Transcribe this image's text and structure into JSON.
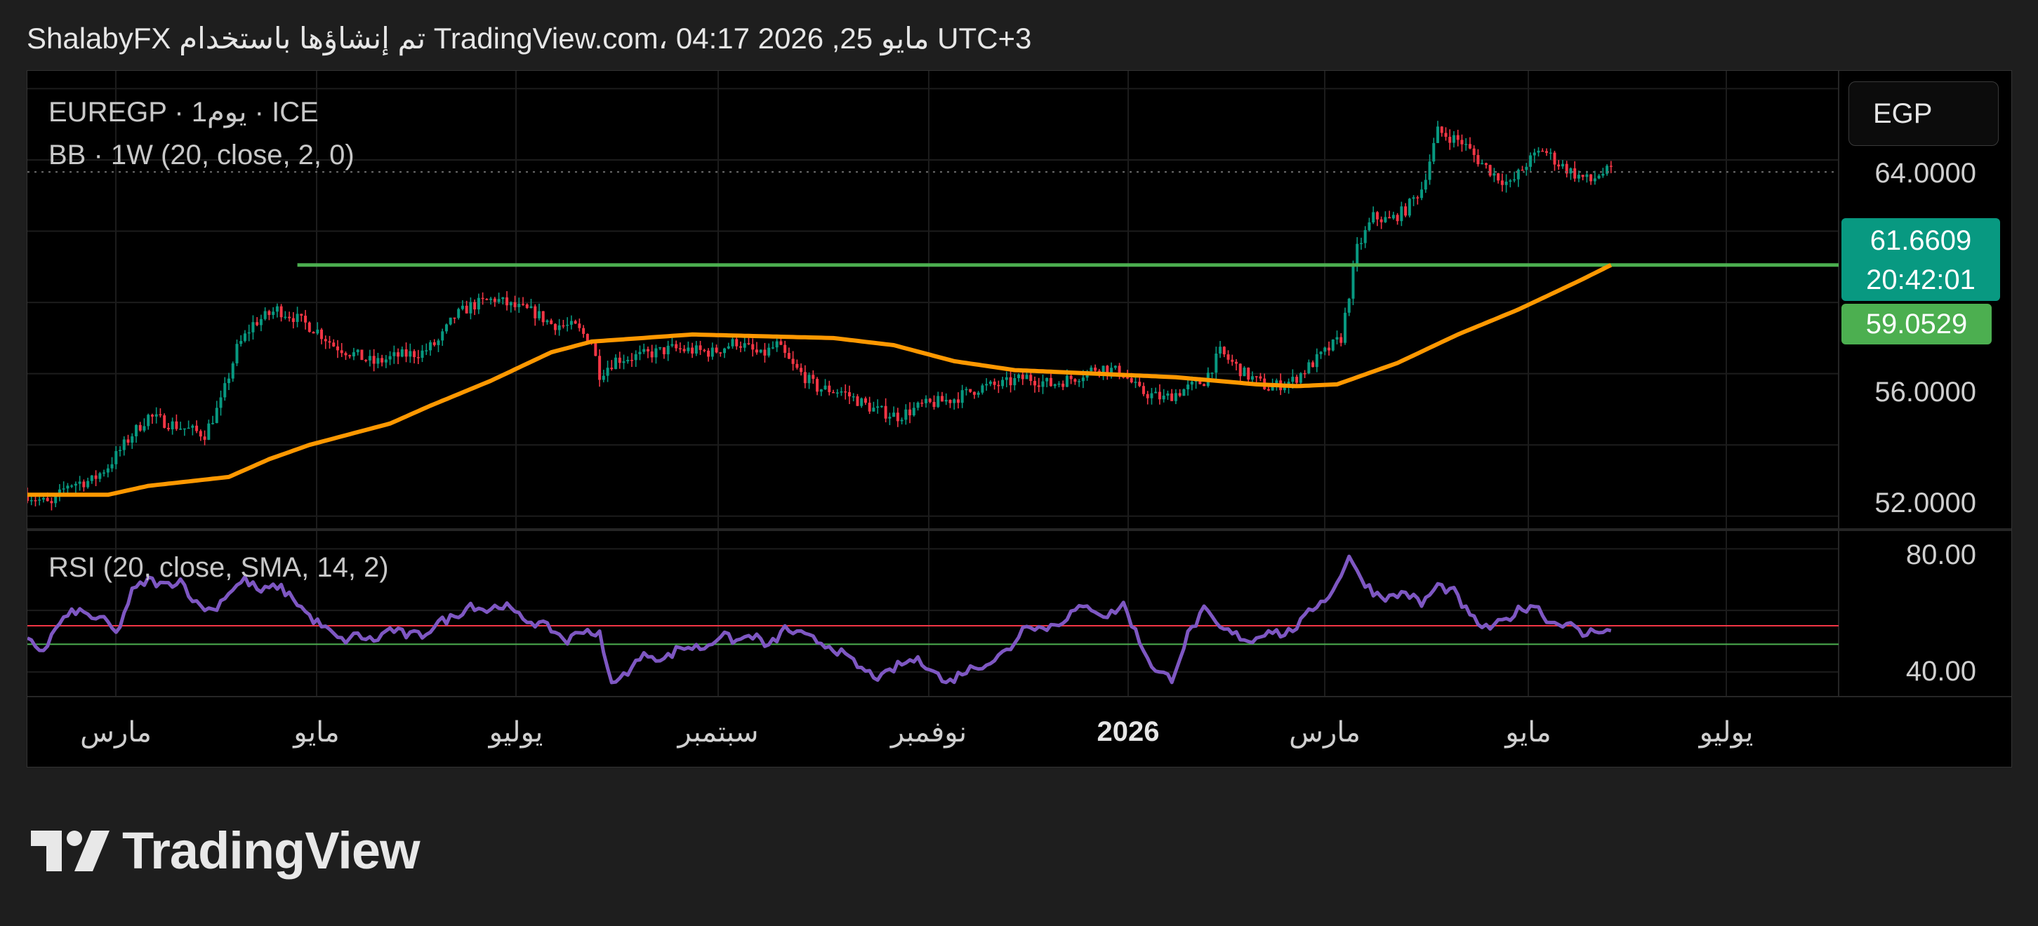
{
  "header": {
    "text": "ShalabyFX تم إنشاؤها باستخدام TradingView.com، 04:17 2026 ,25 مايو UTC+3"
  },
  "legend": {
    "symbol": "EUREGP · 1يوم · ICE",
    "bb": "BB · 1W (20, close, 2, 0)",
    "rsi": "RSI (20, close, SMA, 14, 2)"
  },
  "currency_button": "EGP",
  "price_label": {
    "price": "61.6609",
    "countdown": "20:42:01"
  },
  "bb_label": "59.0529",
  "logo": {
    "text": "TradingView"
  },
  "colors": {
    "background": "#000000",
    "up": "#089981",
    "down": "#f23645",
    "bb_basis": "#ff9800",
    "horizontal_line": "#4caf50",
    "rsi": "#7e57c2",
    "rsi_upper": "#f23645",
    "rsi_lower": "#4caf50"
  },
  "chart_data": [
    {
      "type": "candlestick",
      "title": "EUREGP",
      "y_ticks": [
        "64.0000",
        "56.0000",
        "52.0000"
      ],
      "ylim": [
        51.7,
        64.5
      ],
      "x_ticks": [
        "مارس",
        "مايو",
        "يوليو",
        "سبتمبر",
        "نوفمبر",
        "2026",
        "مارس",
        "مايو",
        "يوليو"
      ],
      "close_path": [
        [
          0,
          52.6
        ],
        [
          6,
          52.3
        ],
        [
          10,
          52.9
        ],
        [
          16,
          53.0
        ],
        [
          20,
          53.4
        ],
        [
          26,
          54.3
        ],
        [
          30,
          54.8
        ],
        [
          38,
          54.5
        ],
        [
          44,
          54.3
        ],
        [
          48,
          55.2
        ],
        [
          52,
          56.7
        ],
        [
          56,
          57.4
        ],
        [
          62,
          57.8
        ],
        [
          66,
          57.6
        ],
        [
          72,
          57.2
        ],
        [
          76,
          56.8
        ],
        [
          82,
          56.5
        ],
        [
          86,
          56.3
        ],
        [
          92,
          56.5
        ],
        [
          98,
          56.6
        ],
        [
          102,
          56.9
        ],
        [
          106,
          57.6
        ],
        [
          110,
          57.9
        ],
        [
          116,
          58.1
        ],
        [
          120,
          57.9
        ],
        [
          126,
          57.7
        ],
        [
          130,
          57.4
        ],
        [
          136,
          57.3
        ],
        [
          140,
          56.9
        ],
        [
          142,
          56.0
        ],
        [
          146,
          56.4
        ],
        [
          152,
          56.5
        ],
        [
          160,
          56.7
        ],
        [
          170,
          56.6
        ],
        [
          176,
          56.9
        ],
        [
          182,
          56.5
        ],
        [
          186,
          56.8
        ],
        [
          190,
          56.2
        ],
        [
          196,
          55.6
        ],
        [
          202,
          55.5
        ],
        [
          210,
          55.0
        ],
        [
          216,
          54.8
        ],
        [
          222,
          55.1
        ],
        [
          230,
          55.3
        ],
        [
          236,
          55.6
        ],
        [
          242,
          55.7
        ],
        [
          248,
          55.9
        ],
        [
          254,
          55.7
        ],
        [
          260,
          55.9
        ],
        [
          266,
          56.2
        ],
        [
          272,
          56.0
        ],
        [
          276,
          55.5
        ],
        [
          282,
          55.3
        ],
        [
          288,
          55.6
        ],
        [
          292,
          55.8
        ],
        [
          296,
          56.6
        ],
        [
          302,
          56.0
        ],
        [
          308,
          55.6
        ],
        [
          314,
          55.8
        ],
        [
          320,
          56.4
        ],
        [
          326,
          57.0
        ],
        [
          330,
          59.5
        ],
        [
          334,
          60.4
        ],
        [
          338,
          60.3
        ],
        [
          342,
          60.6
        ],
        [
          346,
          61.2
        ],
        [
          350,
          62.8
        ],
        [
          356,
          62.5
        ],
        [
          360,
          62.0
        ],
        [
          364,
          61.6
        ],
        [
          368,
          61.3
        ],
        [
          372,
          61.9
        ],
        [
          376,
          62.3
        ],
        [
          380,
          61.9
        ],
        [
          384,
          61.6
        ],
        [
          388,
          61.4
        ],
        [
          390,
          61.6
        ],
        [
          393,
          61.7
        ]
      ],
      "bb_basis": [
        [
          0,
          52.6
        ],
        [
          20,
          52.6
        ],
        [
          30,
          52.85
        ],
        [
          50,
          53.1
        ],
        [
          60,
          53.6
        ],
        [
          70,
          54.0
        ],
        [
          90,
          54.6
        ],
        [
          100,
          55.1
        ],
        [
          115,
          55.8
        ],
        [
          130,
          56.6
        ],
        [
          140,
          56.9
        ],
        [
          165,
          57.1
        ],
        [
          200,
          57.0
        ],
        [
          215,
          56.8
        ],
        [
          230,
          56.35
        ],
        [
          245,
          56.1
        ],
        [
          265,
          56.0
        ],
        [
          285,
          55.9
        ],
        [
          305,
          55.7
        ],
        [
          315,
          55.65
        ],
        [
          325,
          55.7
        ],
        [
          340,
          56.3
        ],
        [
          355,
          57.1
        ],
        [
          370,
          57.8
        ],
        [
          385,
          58.6
        ],
        [
          393,
          59.05
        ]
      ],
      "horizontal_line": 59.05,
      "last_price": 61.6609
    },
    {
      "type": "line",
      "title": "RSI",
      "y_ticks": [
        "80.00",
        "40.00"
      ],
      "ylim": [
        32,
        86
      ],
      "levels": [
        55,
        49
      ],
      "rsi_path": [
        [
          0,
          50
        ],
        [
          4,
          47
        ],
        [
          8,
          56
        ],
        [
          12,
          60
        ],
        [
          16,
          58
        ],
        [
          20,
          56
        ],
        [
          22,
          52
        ],
        [
          26,
          66
        ],
        [
          30,
          70
        ],
        [
          34,
          68
        ],
        [
          38,
          70
        ],
        [
          42,
          62
        ],
        [
          46,
          60
        ],
        [
          50,
          66
        ],
        [
          54,
          70
        ],
        [
          58,
          66
        ],
        [
          62,
          68
        ],
        [
          66,
          64
        ],
        [
          70,
          58
        ],
        [
          74,
          54
        ],
        [
          78,
          50
        ],
        [
          82,
          52
        ],
        [
          86,
          50
        ],
        [
          90,
          54
        ],
        [
          94,
          52
        ],
        [
          98,
          52
        ],
        [
          102,
          56
        ],
        [
          106,
          58
        ],
        [
          110,
          62
        ],
        [
          114,
          60
        ],
        [
          118,
          62
        ],
        [
          122,
          58
        ],
        [
          126,
          56
        ],
        [
          130,
          54
        ],
        [
          134,
          50
        ],
        [
          138,
          54
        ],
        [
          142,
          52
        ],
        [
          144,
          40
        ],
        [
          146,
          36
        ],
        [
          150,
          42
        ],
        [
          154,
          46
        ],
        [
          158,
          44
        ],
        [
          162,
          48
        ],
        [
          168,
          48
        ],
        [
          172,
          52
        ],
        [
          176,
          50
        ],
        [
          180,
          52
        ],
        [
          184,
          48
        ],
        [
          188,
          54
        ],
        [
          192,
          52
        ],
        [
          196,
          50
        ],
        [
          200,
          48
        ],
        [
          204,
          44
        ],
        [
          208,
          40
        ],
        [
          212,
          38
        ],
        [
          216,
          42
        ],
        [
          220,
          44
        ],
        [
          224,
          42
        ],
        [
          228,
          36
        ],
        [
          232,
          40
        ],
        [
          236,
          42
        ],
        [
          240,
          44
        ],
        [
          244,
          48
        ],
        [
          248,
          56
        ],
        [
          252,
          54
        ],
        [
          256,
          56
        ],
        [
          260,
          60
        ],
        [
          264,
          61
        ],
        [
          268,
          58
        ],
        [
          272,
          62
        ],
        [
          276,
          50
        ],
        [
          280,
          40
        ],
        [
          284,
          38
        ],
        [
          288,
          52
        ],
        [
          292,
          60
        ],
        [
          296,
          54
        ],
        [
          300,
          52
        ],
        [
          304,
          50
        ],
        [
          308,
          54
        ],
        [
          312,
          52
        ],
        [
          316,
          56
        ],
        [
          320,
          62
        ],
        [
          324,
          66
        ],
        [
          328,
          78
        ],
        [
          330,
          72
        ],
        [
          334,
          66
        ],
        [
          338,
          64
        ],
        [
          342,
          66
        ],
        [
          346,
          62
        ],
        [
          350,
          68
        ],
        [
          354,
          66
        ],
        [
          358,
          58
        ],
        [
          362,
          54
        ],
        [
          366,
          56
        ],
        [
          370,
          60
        ],
        [
          374,
          62
        ],
        [
          378,
          56
        ],
        [
          382,
          56
        ],
        [
          386,
          52
        ],
        [
          390,
          54
        ],
        [
          393,
          53
        ]
      ]
    }
  ]
}
